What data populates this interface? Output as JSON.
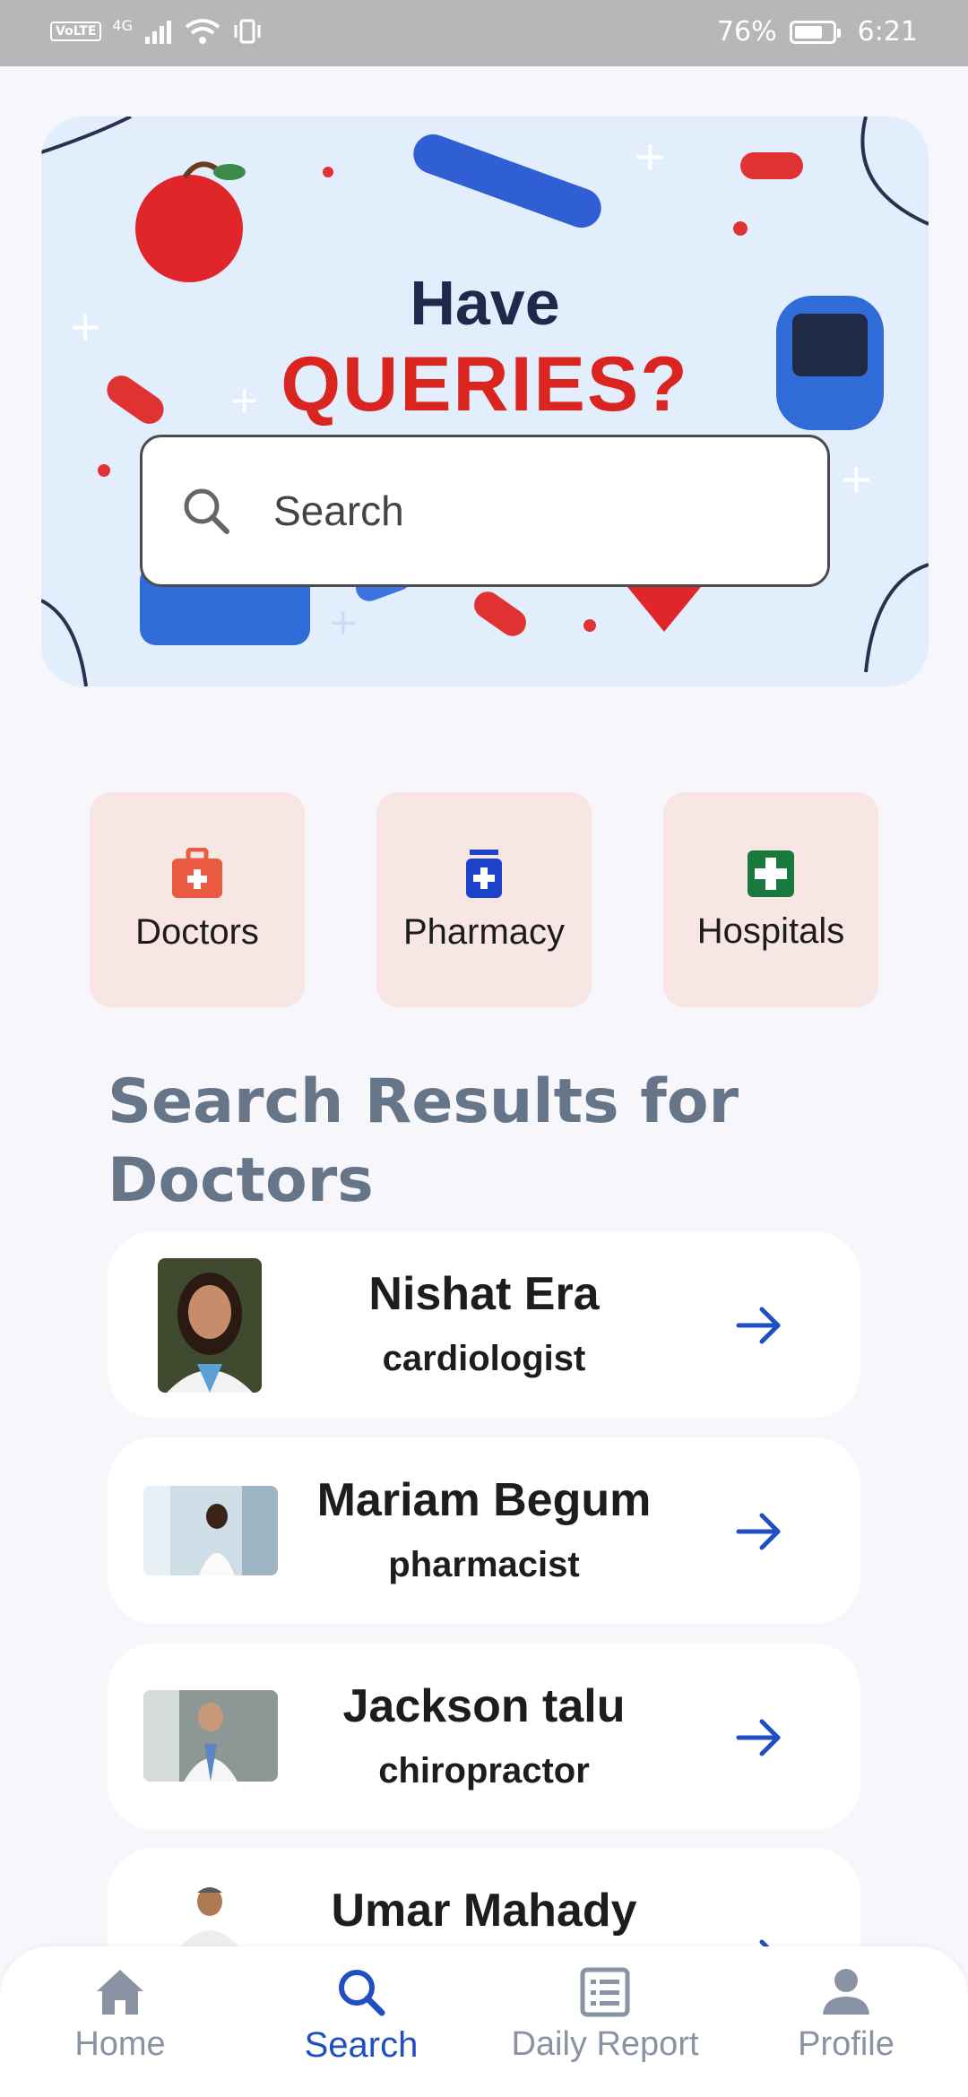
{
  "status_bar": {
    "network": "4G",
    "volte": "VoLTE",
    "battery": "76%",
    "time": "6:21"
  },
  "hero": {
    "line1": "Have",
    "line2": "QUERIES?"
  },
  "search": {
    "placeholder": "Search"
  },
  "categories": [
    {
      "label": "Doctors",
      "icon": "medical-bag-icon",
      "color": "#e95c43"
    },
    {
      "label": "Pharmacy",
      "icon": "medicine-bottle-icon",
      "color": "#1d44c8"
    },
    {
      "label": "Hospitals",
      "icon": "hospital-cross-icon",
      "color": "#177a3c"
    }
  ],
  "results": {
    "title": "Search Results for Doctors",
    "items": [
      {
        "name": "Nishat Era",
        "specialty": "cardiologist"
      },
      {
        "name": "Mariam Begum",
        "specialty": "pharmacist"
      },
      {
        "name": "Jackson talu",
        "specialty": "chiropractor"
      },
      {
        "name": "Umar Mahady",
        "specialty": ""
      }
    ]
  },
  "nav": [
    {
      "label": "Home",
      "icon": "home-icon"
    },
    {
      "label": "Search",
      "icon": "search-icon"
    },
    {
      "label": "Daily Report",
      "icon": "report-icon"
    },
    {
      "label": "Profile",
      "icon": "profile-icon"
    }
  ],
  "colors": {
    "accent": "#1f4fc2",
    "card_tint": "#f8e6e5",
    "title": "#677589",
    "hero_bg": "#e2eefc"
  }
}
